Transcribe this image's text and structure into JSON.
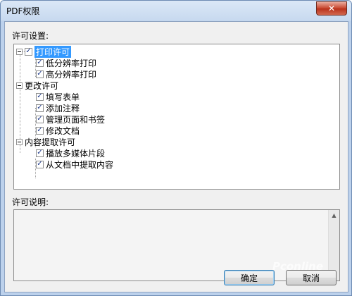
{
  "window": {
    "title": "PDF权限"
  },
  "labels": {
    "permissions": "许可设置:",
    "description": "许可说明:"
  },
  "tree": {
    "groups": [
      {
        "label": "打印许可",
        "children": [
          "低分辨率打印",
          "高分辨率打印"
        ]
      },
      {
        "label": "更改许可",
        "children": [
          "填写表单",
          "添加注释",
          "管理页面和书签",
          "修改文档"
        ]
      },
      {
        "label": "内容提取许可",
        "children": [
          "播放多媒体片段",
          "从文档中提取内容"
        ]
      }
    ]
  },
  "buttons": {
    "ok": "确定",
    "cancel": "取消"
  },
  "watermark": "Pconline",
  "colors": {
    "selection": "#3399ff",
    "close": "#c7442c",
    "title_bar": "#c7d9ef"
  }
}
